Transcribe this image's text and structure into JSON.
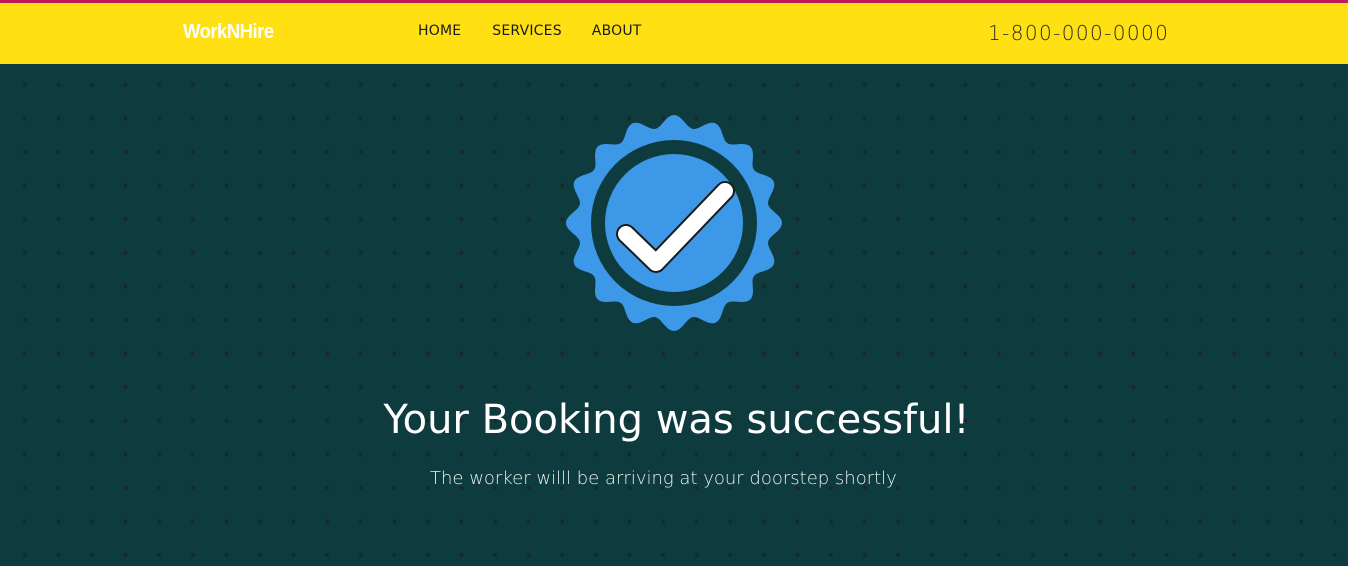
{
  "header": {
    "logo": "WorkNHire",
    "nav": {
      "home": "HOME",
      "services": "SERVICES",
      "about": "ABOUT"
    },
    "phone": "1-800-000-0000"
  },
  "main": {
    "badge_icon": "verified-check-badge-icon",
    "headline": "Your Booking was successful!",
    "subline": "The worker willl be arriving at your doorstep shortly"
  },
  "colors": {
    "header_bg": "#ffe012",
    "hero_bg": "#0e3b3d",
    "badge_blue": "#3d98e8",
    "accent_line": "#c2185b"
  }
}
